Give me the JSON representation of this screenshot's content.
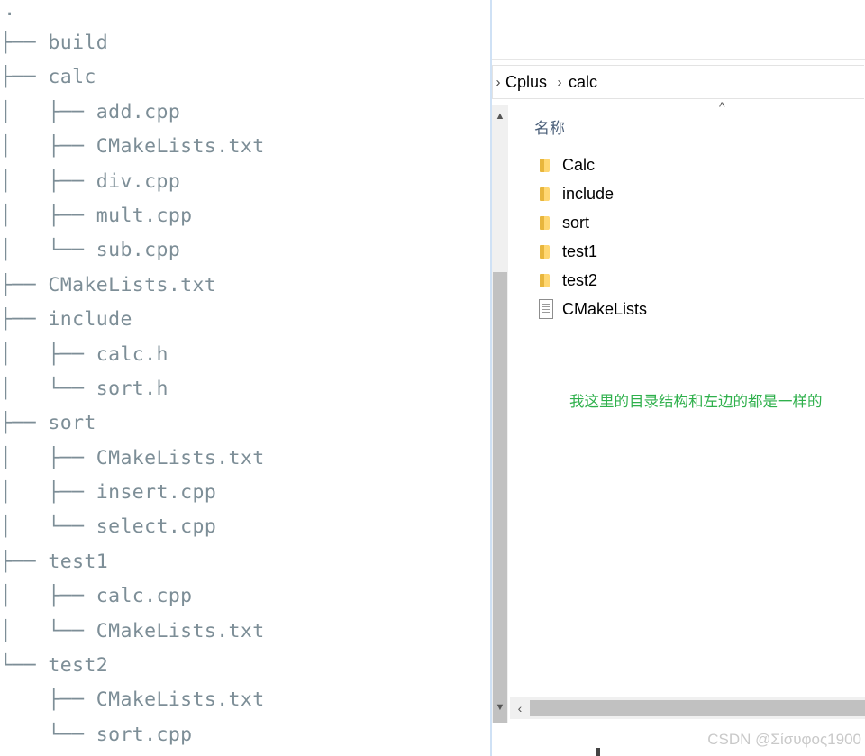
{
  "tree": {
    "root": ".",
    "lines": [
      "├── build",
      "├── calc",
      "│   ├── add.cpp",
      "│   ├── CMakeLists.txt",
      "│   ├── div.cpp",
      "│   ├── mult.cpp",
      "│   └── sub.cpp",
      "├── CMakeLists.txt",
      "├── include",
      "│   ├── calc.h",
      "│   └── sort.h",
      "├── sort",
      "│   ├── CMakeLists.txt",
      "│   ├── insert.cpp",
      "│   └── select.cpp",
      "├── test1",
      "│   ├── calc.cpp",
      "│   └── CMakeLists.txt",
      "└── test2",
      "    ├── CMakeLists.txt",
      "    └── sort.cpp"
    ]
  },
  "explorer": {
    "breadcrumb": [
      "Cplus",
      "calc"
    ],
    "column_header": "名称",
    "items": [
      {
        "name": "Calc",
        "icon": "folder-icon"
      },
      {
        "name": "include",
        "icon": "folder-icon"
      },
      {
        "name": "sort",
        "icon": "folder-icon"
      },
      {
        "name": "test1",
        "icon": "folder-icon"
      },
      {
        "name": "test2",
        "icon": "folder-icon"
      },
      {
        "name": "CMakeLists",
        "icon": "document-icon"
      }
    ]
  },
  "annotation": "我这里的目录结构和左边的都是一样的",
  "watermark": "CSDN @Σίσυφος1900",
  "colors": {
    "tree_text": "#7d8e97",
    "annotation": "#2fb04c",
    "folder": "#ffd772",
    "header": "#4c607a"
  }
}
